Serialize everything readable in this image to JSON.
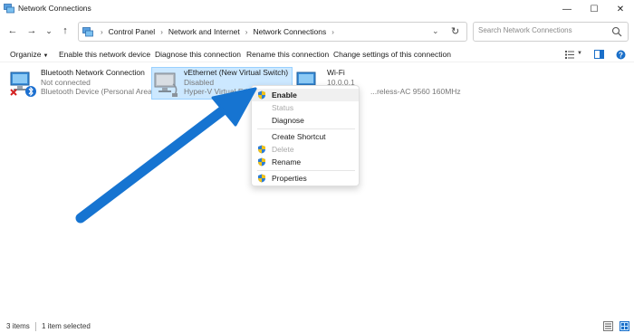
{
  "window": {
    "title": "Network Connections"
  },
  "window_controls": {
    "minimize": "—",
    "maximize": "☐",
    "close": "✕"
  },
  "nav": {
    "back": "←",
    "forward": "→",
    "recent": "⌄",
    "up": "↑"
  },
  "address": {
    "breadcrumbs": [
      "Control Panel",
      "Network and Internet",
      "Network Connections"
    ],
    "separator": "›",
    "dropdown": "⌄",
    "refresh": "↻"
  },
  "search": {
    "placeholder": "Search Network Connections"
  },
  "commands": {
    "organize": "Organize",
    "enable_device": "Enable this network device",
    "diagnose": "Diagnose this connection",
    "rename": "Rename this connection",
    "change_settings": "Change settings of this connection"
  },
  "connections": [
    {
      "name": "Bluetooth Network Connection",
      "status": "Not connected",
      "device": "Bluetooth Device (Personal Area ..."
    },
    {
      "name": "vEthernet (New Virtual Switch)",
      "status": "Disabled",
      "device": "Hyper-V Virtual Etherne..."
    },
    {
      "name": "Wi-Fi",
      "status": "10.0.0.1",
      "device": "...reless-AC 9560 160MHz"
    }
  ],
  "context_menu": {
    "enable": "Enable",
    "status": "Status",
    "diagnose": "Diagnose",
    "create_shortcut": "Create Shortcut",
    "delete": "Delete",
    "rename": "Rename",
    "properties": "Properties"
  },
  "statusbar": {
    "items": "3 items",
    "selected": "1 item selected"
  },
  "colors": {
    "accent": "#0a6ccf",
    "selection": "#cce8ff",
    "annotation_arrow": "#1674d1"
  }
}
